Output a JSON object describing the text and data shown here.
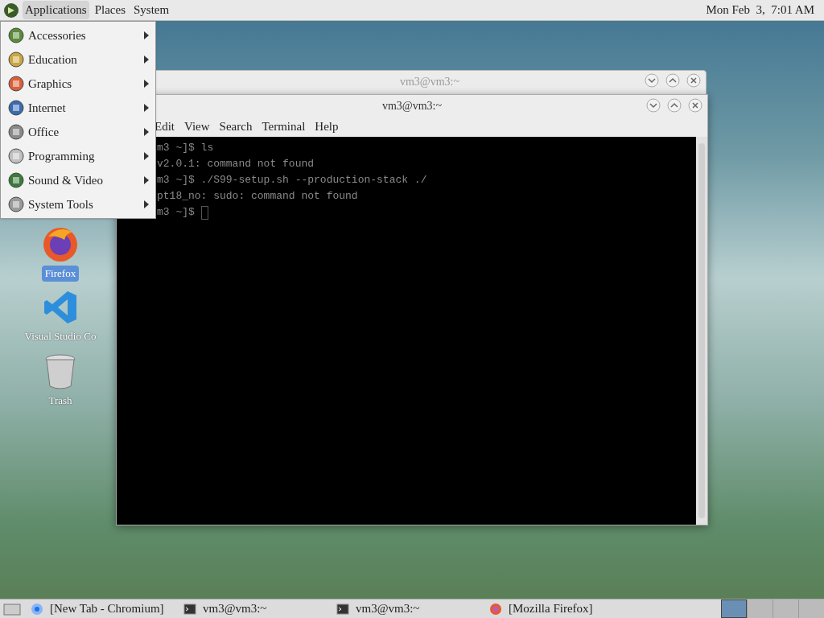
{
  "top_panel": {
    "menus": [
      {
        "label": "Applications",
        "selected": true
      },
      {
        "label": "Places",
        "selected": false
      },
      {
        "label": "System",
        "selected": false
      }
    ],
    "clock": "Mon Feb  3,  7:01 AM"
  },
  "applications_menu": [
    {
      "label": "Accessories"
    },
    {
      "label": "Education"
    },
    {
      "label": "Graphics"
    },
    {
      "label": "Internet"
    },
    {
      "label": "Office"
    },
    {
      "label": "Programming"
    },
    {
      "label": "Sound & Video"
    },
    {
      "label": "System Tools"
    }
  ],
  "desktop_icons": [
    {
      "kind": "firefox",
      "label": "Firefox",
      "selected": true
    },
    {
      "kind": "vscode",
      "label": "Visual Studio Co",
      "selected": false
    },
    {
      "kind": "trash",
      "label": "Trash",
      "selected": false
    }
  ],
  "back_window": {
    "title": "vm3@vm3:~"
  },
  "terminal_window": {
    "title": "vm3@vm3:~",
    "menus": [
      "Edit",
      "View",
      "Search",
      "Terminal",
      "Help"
    ],
    "lines": [
      "m3 ~]$ ls",
      "v2.0.1: command not found",
      "m3 ~]$ ./S99-setup.sh --production-stack ./",
      "pt18_no: sudo: command not found",
      "m3 ~]$"
    ]
  },
  "taskbar": [
    {
      "kind": "chromium",
      "label": "[New Tab - Chromium]"
    },
    {
      "kind": "terminal",
      "label": "vm3@vm3:~"
    },
    {
      "kind": "terminal",
      "label": "vm3@vm3:~"
    },
    {
      "kind": "firefox",
      "label": "[Mozilla Firefox]"
    }
  ]
}
